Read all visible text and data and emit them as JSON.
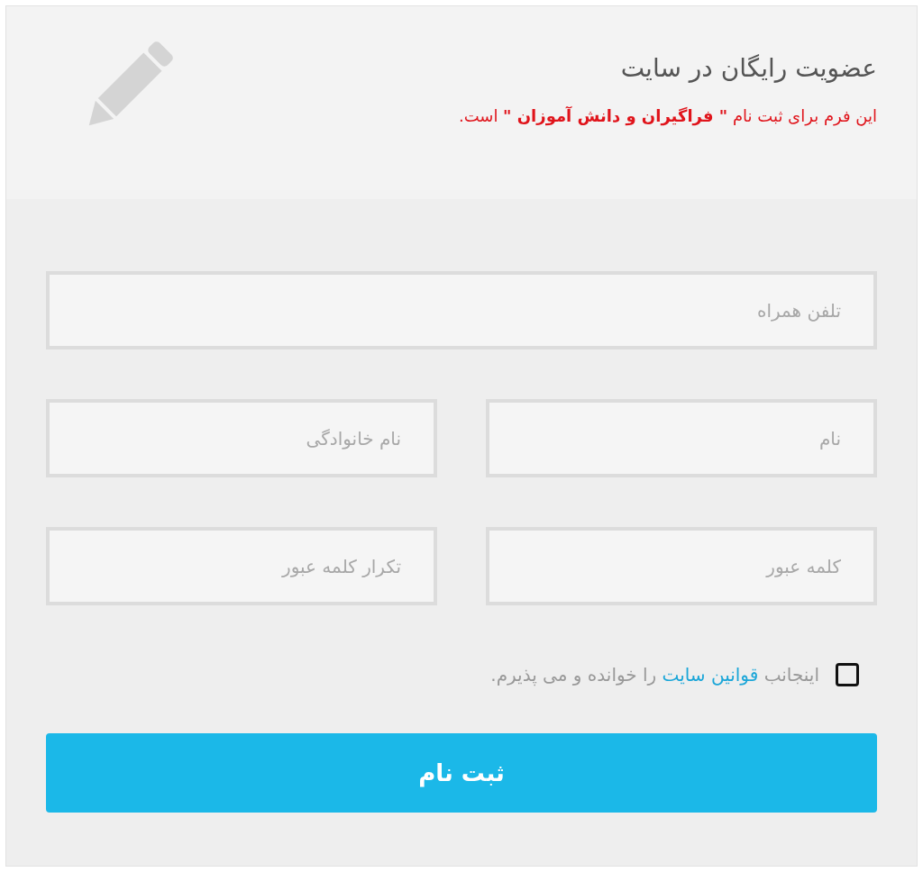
{
  "header": {
    "title": "عضویت رایگان در سایت",
    "subtitle": "این فرم برای ثبت نام  **\" فراگیران و دانش آموزان \"**  است."
  },
  "fields": [
    {
      "placeholder": "تلفن همراه",
      "kind": "full"
    },
    {
      "placeholder": "نام",
      "kind": "half"
    },
    {
      "placeholder": "نام خانوادگی",
      "kind": "half"
    },
    {
      "placeholder": "کلمه عبور",
      "kind": "half"
    },
    {
      "placeholder": "تکرار کلمه عبور",
      "kind": "half"
    }
  ],
  "terms": {
    "checked": false,
    "before": "اینجانب",
    "link": "قوانین سایت",
    "after": "را خوانده و می پذیرم."
  },
  "submit": {
    "label": "ثبت نام"
  }
}
